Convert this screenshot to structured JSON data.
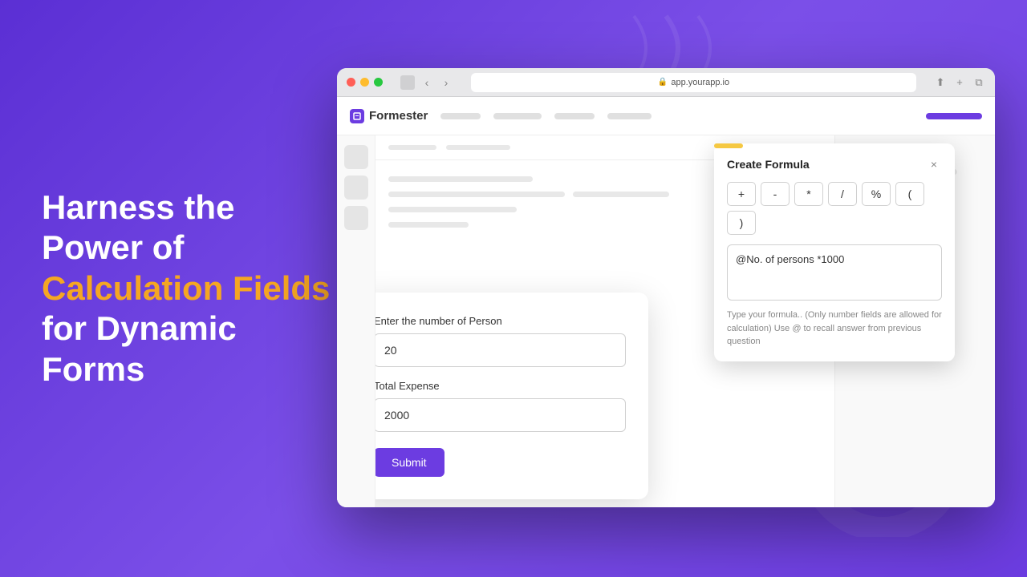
{
  "background": {
    "color": "#6c3ce1"
  },
  "left_content": {
    "line1": "Harness the",
    "line2": "Power of",
    "highlight": "Calculation Fields",
    "line3": "for Dynamic",
    "line4": "Forms"
  },
  "browser": {
    "dots": [
      "red",
      "yellow",
      "green"
    ],
    "address": "app.yourapp.io",
    "logo_text": "Formester"
  },
  "formula_panel": {
    "title": "Create Formula",
    "close_label": "×",
    "operators": [
      "+",
      "-",
      "*",
      "/",
      "%",
      "(",
      ")"
    ],
    "formula_text": "@No. of persons *1000",
    "hint": "Type your formula.. (Only number fields are allowed for calculation) Use @ to recall answer from previous question"
  },
  "form": {
    "field1_label": "Enter the number of Person",
    "field1_value": "20",
    "field2_label": "Total Expense",
    "field2_value": "2000",
    "submit_label": "Submit"
  }
}
